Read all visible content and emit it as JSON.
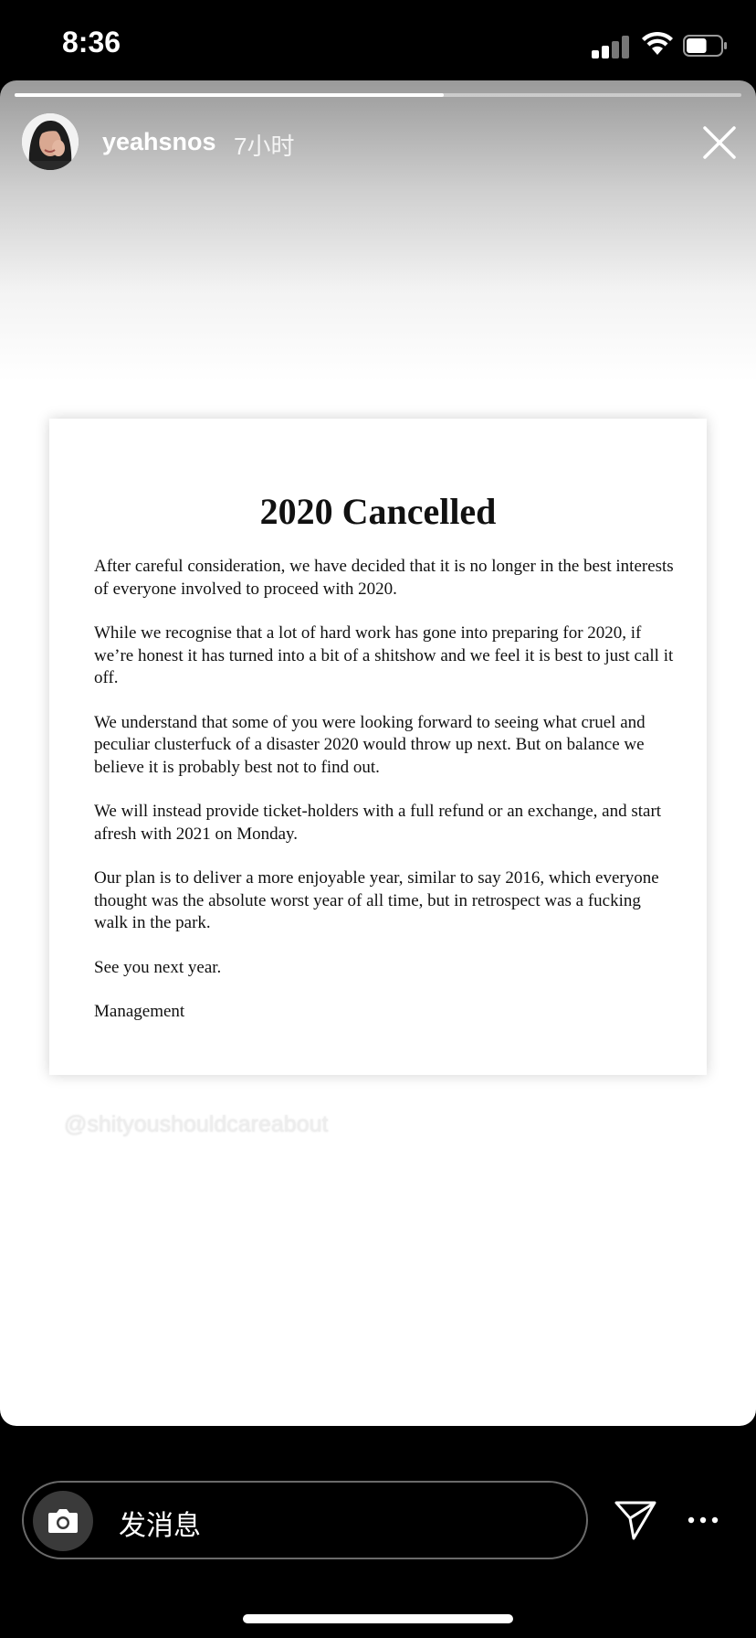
{
  "status_bar": {
    "time": "8:36",
    "signal_bars_active": 2,
    "battery_level": 0.6
  },
  "story": {
    "progress": 0.59,
    "username": "yeahsnos",
    "time_ago": "7小时",
    "document": {
      "title": "2020 Cancelled",
      "paragraphs": [
        "After careful consideration, we have decided that it is no longer in the best interests of everyone involved to proceed with 2020.",
        "While we recognise that a lot of hard work has gone into preparing for 2020, if we’re honest it has turned into a bit of a shitshow and we feel it is best to just call it off.",
        "We understand that some of you were looking forward to seeing what cruel and peculiar clusterfuck of a disaster 2020 would throw up next. But on balance we believe it is probably best not to find out.",
        "We will instead provide ticket-holders with a full refund or an exchange, and start afresh with 2021 on Monday.",
        "Our plan is to deliver a more enjoyable year, similar to say 2016, which everyone thought was the absolute worst year of all time, but in retrospect was a fucking walk in the park.",
        "See you next year.",
        "Management"
      ]
    },
    "watermark": "@shityoushouldcareabout"
  },
  "reply_bar": {
    "placeholder": "发消息"
  },
  "icons": {
    "camera": "camera-icon",
    "send": "send-icon",
    "more": "more-icon",
    "close": "close-icon"
  },
  "colors": {
    "background": "#000000",
    "text_light": "#ffffff",
    "camera_bg": "#3a3a3a"
  }
}
